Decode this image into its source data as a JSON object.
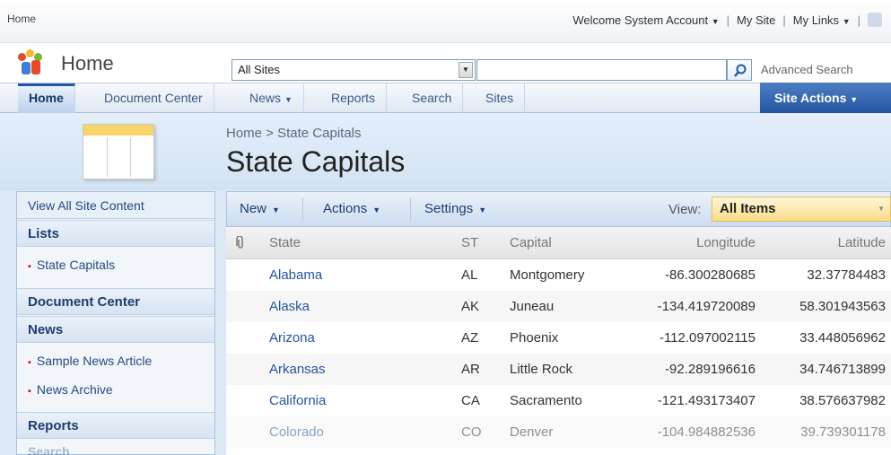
{
  "topbar": {
    "home_label": "Home",
    "welcome": "Welcome System Account",
    "my_site": "My Site",
    "my_links": "My Links"
  },
  "header": {
    "site_title": "Home",
    "scope_value": "All Sites",
    "search_placeholder": "",
    "advanced_search": "Advanced Search"
  },
  "nav": {
    "tabs": [
      {
        "label": "Home"
      },
      {
        "label": "Document Center"
      },
      {
        "label": "News"
      },
      {
        "label": "Reports"
      },
      {
        "label": "Search"
      },
      {
        "label": "Sites"
      }
    ],
    "site_actions": "Site Actions"
  },
  "page": {
    "breadcrumb": "Home > State Capitals",
    "title": "State Capitals"
  },
  "leftnav": {
    "view_all": "View All Site Content",
    "lists_header": "Lists",
    "lists_item": "State Capitals",
    "doc_center": "Document Center",
    "news_header": "News",
    "news_item_1": "Sample News Article",
    "news_item_2": "News Archive",
    "reports": "Reports",
    "search": "Search"
  },
  "toolbar": {
    "new": "New",
    "actions": "Actions",
    "settings": "Settings",
    "view_label": "View:",
    "view_value": "All Items"
  },
  "table": {
    "headers": {
      "state": "State",
      "st": "ST",
      "capital": "Capital",
      "longitude": "Longitude",
      "latitude": "Latitude"
    },
    "rows": [
      {
        "state": "Alabama",
        "st": "AL",
        "capital": "Montgomery",
        "longitude": "-86.300280685",
        "latitude": "32.37784483"
      },
      {
        "state": "Alaska",
        "st": "AK",
        "capital": "Juneau",
        "longitude": "-134.419720089",
        "latitude": "58.301943563"
      },
      {
        "state": "Arizona",
        "st": "AZ",
        "capital": "Phoenix",
        "longitude": "-112.097002115",
        "latitude": "33.448056962"
      },
      {
        "state": "Arkansas",
        "st": "AR",
        "capital": "Little Rock",
        "longitude": "-92.289196616",
        "latitude": "34.746713899"
      },
      {
        "state": "California",
        "st": "CA",
        "capital": "Sacramento",
        "longitude": "-121.493173407",
        "latitude": "38.576637982"
      },
      {
        "state": "Colorado",
        "st": "CO",
        "capital": "Denver",
        "longitude": "-104.984882536",
        "latitude": "39.739301178"
      }
    ]
  }
}
